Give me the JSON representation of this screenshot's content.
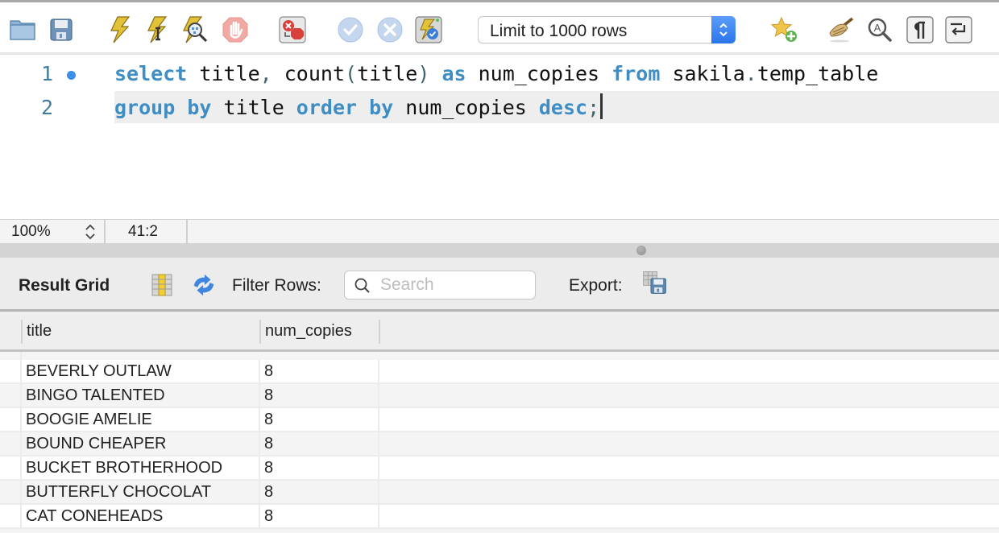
{
  "toolbar": {
    "buttons": [
      {
        "name": "open-file",
        "tooltip_icon": "folder-icon"
      },
      {
        "name": "save-file",
        "tooltip_icon": "floppy-disk-icon"
      },
      {
        "name": "execute-all",
        "tooltip_icon": "lightning-icon"
      },
      {
        "name": "execute-current",
        "tooltip_icon": "lightning-cursor-icon"
      },
      {
        "name": "explain",
        "tooltip_icon": "lightning-magnifier-icon"
      },
      {
        "name": "stop",
        "tooltip_icon": "stop-hand-icon"
      },
      {
        "name": "toggle-stop-on-error",
        "tooltip_icon": "error-stop-toggle-icon"
      },
      {
        "name": "commit",
        "tooltip_icon": "check-circle-icon"
      },
      {
        "name": "rollback",
        "tooltip_icon": "x-circle-icon"
      },
      {
        "name": "autocommit",
        "tooltip_icon": "lightning-check-icon"
      },
      {
        "name": "add-snippet",
        "tooltip_icon": "star-plus-icon"
      },
      {
        "name": "beautify",
        "tooltip_icon": "broom-icon"
      },
      {
        "name": "find",
        "tooltip_icon": "find-text-icon"
      },
      {
        "name": "invisible-chars",
        "tooltip_icon": "pilcrow-icon"
      },
      {
        "name": "word-wrap",
        "tooltip_icon": "wrap-icon"
      }
    ],
    "limit_select": {
      "value": "Limit to 1000 rows"
    }
  },
  "editor": {
    "lines": [
      {
        "number": "1",
        "has_marker": true
      },
      {
        "number": "2",
        "has_marker": false
      }
    ],
    "line1": {
      "t1": "select",
      "t2": " title",
      "t3": ",",
      "t4": " count",
      "t5": "(",
      "t6": "title",
      "t7": ")",
      "t8": " as",
      "t9": " num_copies ",
      "t10": "from",
      "t11": " sakila",
      "t12": ".",
      "t13": "temp_table"
    },
    "line2": {
      "t1": "group",
      "t2": " ",
      "t3": "by",
      "t4": " title ",
      "t5": "order",
      "t6": " ",
      "t7": "by",
      "t8": " num_copies ",
      "t9": "desc",
      "t10": ";"
    }
  },
  "statusbar": {
    "zoom": "100%",
    "cursor_position": "41:2"
  },
  "result": {
    "title": "Result Grid",
    "filter_label": "Filter Rows:",
    "search_placeholder": "Search",
    "search_value": "",
    "export_label": "Export:",
    "columns": [
      "title",
      "num_copies"
    ],
    "rows": [
      {
        "title": "BEVERLY OUTLAW",
        "num_copies": "8"
      },
      {
        "title": "BINGO TALENTED",
        "num_copies": "8"
      },
      {
        "title": "BOOGIE AMELIE",
        "num_copies": "8"
      },
      {
        "title": "BOUND CHEAPER",
        "num_copies": "8"
      },
      {
        "title": "BUCKET BROTHERHOOD",
        "num_copies": "8"
      },
      {
        "title": "BUTTERFLY CHOCOLAT",
        "num_copies": "8"
      },
      {
        "title": "CAT CONEHEADS",
        "num_copies": "8"
      }
    ]
  },
  "colors": {
    "keyword": "#3e8ec5",
    "line_number": "#3f7e9c",
    "marker": "#3a8fe6",
    "select_accent": "#2c74ec"
  }
}
